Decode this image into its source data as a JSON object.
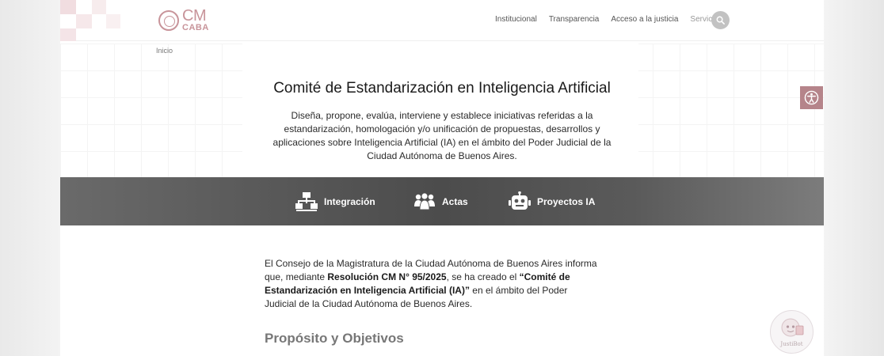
{
  "header": {
    "logo": {
      "line1": "CM",
      "line2": "CABA"
    },
    "nav": [
      {
        "label": "Institucional"
      },
      {
        "label": "Transparencia"
      },
      {
        "label": "Acceso a la justicia"
      },
      {
        "label": "Servicios"
      }
    ],
    "search_icon": "search-icon"
  },
  "breadcrumb": "Inicio",
  "hero": {
    "title": "Comité de Estandarización en Inteligencia Artificial",
    "description": "Diseña, propone, evalúa, interviene y establece iniciativas referidas a la estandarización, homologación y/o unificación de propuestas, desarrollos y aplicaciones sobre Inteligencia Artificial (IA) en el ámbito del Poder Judicial de la Ciudad Autónoma de Buenos Aires."
  },
  "band": {
    "items": [
      {
        "label": "Integración",
        "icon": "network-icon"
      },
      {
        "label": "Actas",
        "icon": "people-group-icon"
      },
      {
        "label": "Proyectos IA",
        "icon": "robot-icon"
      }
    ]
  },
  "content": {
    "p1_part1": "El Consejo de la Magistratura de la Ciudad Autónoma de Buenos Aires informa que, mediante ",
    "p1_bold1": "Resolución CM N° 95/2025",
    "p1_part2": ", se ha creado el ",
    "p1_bold2": "“Comité de Estandarización en Inteligencia Artificial (IA)”",
    "p1_part3": " en el ámbito del Poder Judicial de la Ciudad Autónoma de Buenos Aires.",
    "subheading": "Propósito y Objetivos"
  },
  "widgets": {
    "accessibility_icon": "accessibility-icon",
    "chatbot_label": "JustiBot"
  },
  "colors": {
    "brand": "#c8949a",
    "accessibility_tab": "#b5848a",
    "band_dark": "#4c4c4c"
  }
}
